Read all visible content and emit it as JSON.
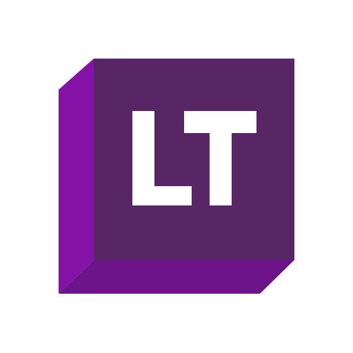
{
  "logo": {
    "text": "LT",
    "colors": {
      "front_face": "#582565",
      "left_face": "#8412A7",
      "bottom_face": "#6E1489",
      "letters": "#FFFFFF",
      "background": "#FFFFFF"
    }
  }
}
